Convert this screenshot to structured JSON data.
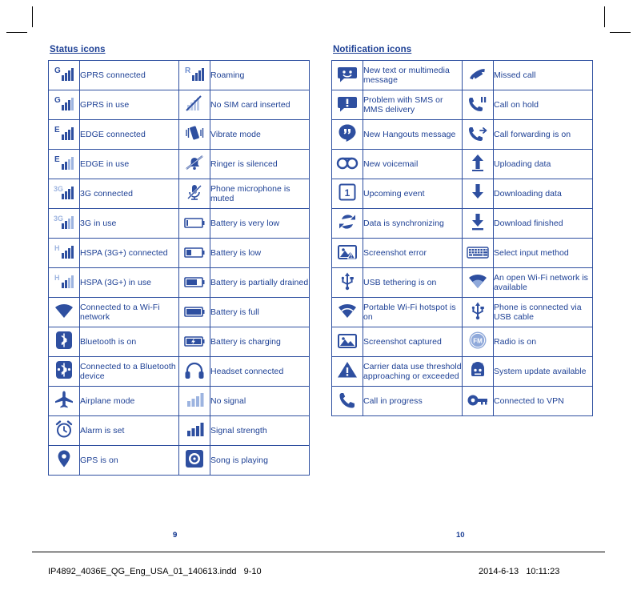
{
  "document": {
    "left_section_title": "Status icons",
    "right_section_title": "Notification icons",
    "folio_left": "9",
    "folio_right": "10",
    "footer_left": "IP4892_4036E_QG_Eng_USA_01_140613.indd   9-10",
    "footer_right": "2014-6-13   10:11:23",
    "accent_color": "#1c3f94"
  },
  "status_icons": [
    {
      "icon": "gprs-connected-icon",
      "label": "GPRS connected"
    },
    {
      "icon": "roaming-icon",
      "label": "Roaming"
    },
    {
      "icon": "gprs-in-use-icon",
      "label": "GPRS in use"
    },
    {
      "icon": "no-sim-card-icon",
      "label": "No SIM card inserted"
    },
    {
      "icon": "edge-connected-icon",
      "label": "EDGE connected"
    },
    {
      "icon": "vibrate-mode-icon",
      "label": "Vibrate mode"
    },
    {
      "icon": "edge-in-use-icon",
      "label": "EDGE in use"
    },
    {
      "icon": "ringer-silenced-icon",
      "label": "Ringer is silenced"
    },
    {
      "icon": "3g-connected-icon",
      "label": "3G connected"
    },
    {
      "icon": "microphone-muted-icon",
      "label": "Phone microphone is muted"
    },
    {
      "icon": "3g-in-use-icon",
      "label": "3G in use"
    },
    {
      "icon": "battery-very-low-icon",
      "label": "Battery is very low"
    },
    {
      "icon": "hspa-connected-icon",
      "label": "HSPA (3G+) connected"
    },
    {
      "icon": "battery-low-icon",
      "label": "Battery is low"
    },
    {
      "icon": "hspa-in-use-icon",
      "label": "HSPA (3G+) in use"
    },
    {
      "icon": "battery-partially-drained-icon",
      "label": "Battery is partially drained"
    },
    {
      "icon": "wifi-connected-icon",
      "label": "Connected to a Wi-Fi network"
    },
    {
      "icon": "battery-full-icon",
      "label": "Battery is full"
    },
    {
      "icon": "bluetooth-on-icon",
      "label": "Bluetooth is on"
    },
    {
      "icon": "battery-charging-icon",
      "label": "Battery is charging"
    },
    {
      "icon": "bluetooth-connected-icon",
      "label": "Connected to a Bluetooth device"
    },
    {
      "icon": "headset-connected-icon",
      "label": "Headset connected"
    },
    {
      "icon": "airplane-mode-icon",
      "label": "Airplane mode"
    },
    {
      "icon": "no-signal-icon",
      "label": "No signal"
    },
    {
      "icon": "alarm-set-icon",
      "label": "Alarm is set"
    },
    {
      "icon": "signal-strength-icon",
      "label": "Signal strength"
    },
    {
      "icon": "gps-on-icon",
      "label": "GPS is on"
    },
    {
      "icon": "song-playing-icon",
      "label": "Song is playing"
    }
  ],
  "notification_icons": [
    {
      "icon": "new-message-icon",
      "label": "New text or multimedia message"
    },
    {
      "icon": "missed-call-icon",
      "label": "Missed call"
    },
    {
      "icon": "sms-problem-icon",
      "label": "Problem with SMS or MMS delivery"
    },
    {
      "icon": "call-on-hold-icon",
      "label": "Call on hold"
    },
    {
      "icon": "hangouts-message-icon",
      "label": "New Hangouts message"
    },
    {
      "icon": "call-forwarding-icon",
      "label": "Call forwarding is on"
    },
    {
      "icon": "new-voicemail-icon",
      "label": "New voicemail"
    },
    {
      "icon": "uploading-data-icon",
      "label": "Uploading data"
    },
    {
      "icon": "upcoming-event-icon",
      "label": "Upcoming event"
    },
    {
      "icon": "downloading-data-icon",
      "label": "Downloading data"
    },
    {
      "icon": "data-syncing-icon",
      "label": "Data is synchronizing"
    },
    {
      "icon": "download-finished-icon",
      "label": "Download finished"
    },
    {
      "icon": "screenshot-error-icon",
      "label": "Screenshot error"
    },
    {
      "icon": "select-input-method-icon",
      "label": "Select input method"
    },
    {
      "icon": "usb-tethering-icon",
      "label": "USB tethering is on"
    },
    {
      "icon": "open-wifi-available-icon",
      "label": "An open Wi-Fi network is available"
    },
    {
      "icon": "portable-hotspot-icon",
      "label": "Portable Wi-Fi hotspot is on"
    },
    {
      "icon": "usb-connected-icon",
      "label": "Phone is connected via USB cable"
    },
    {
      "icon": "screenshot-captured-icon",
      "label": "Screenshot captured"
    },
    {
      "icon": "radio-on-icon",
      "label": "Radio is on"
    },
    {
      "icon": "carrier-data-warning-icon",
      "label": "Carrier data use threshold approaching or exceeded"
    },
    {
      "icon": "system-update-icon",
      "label": "System update available"
    },
    {
      "icon": "call-in-progress-icon",
      "label": "Call in progress"
    },
    {
      "icon": "vpn-connected-icon",
      "label": "Connected to VPN"
    }
  ]
}
